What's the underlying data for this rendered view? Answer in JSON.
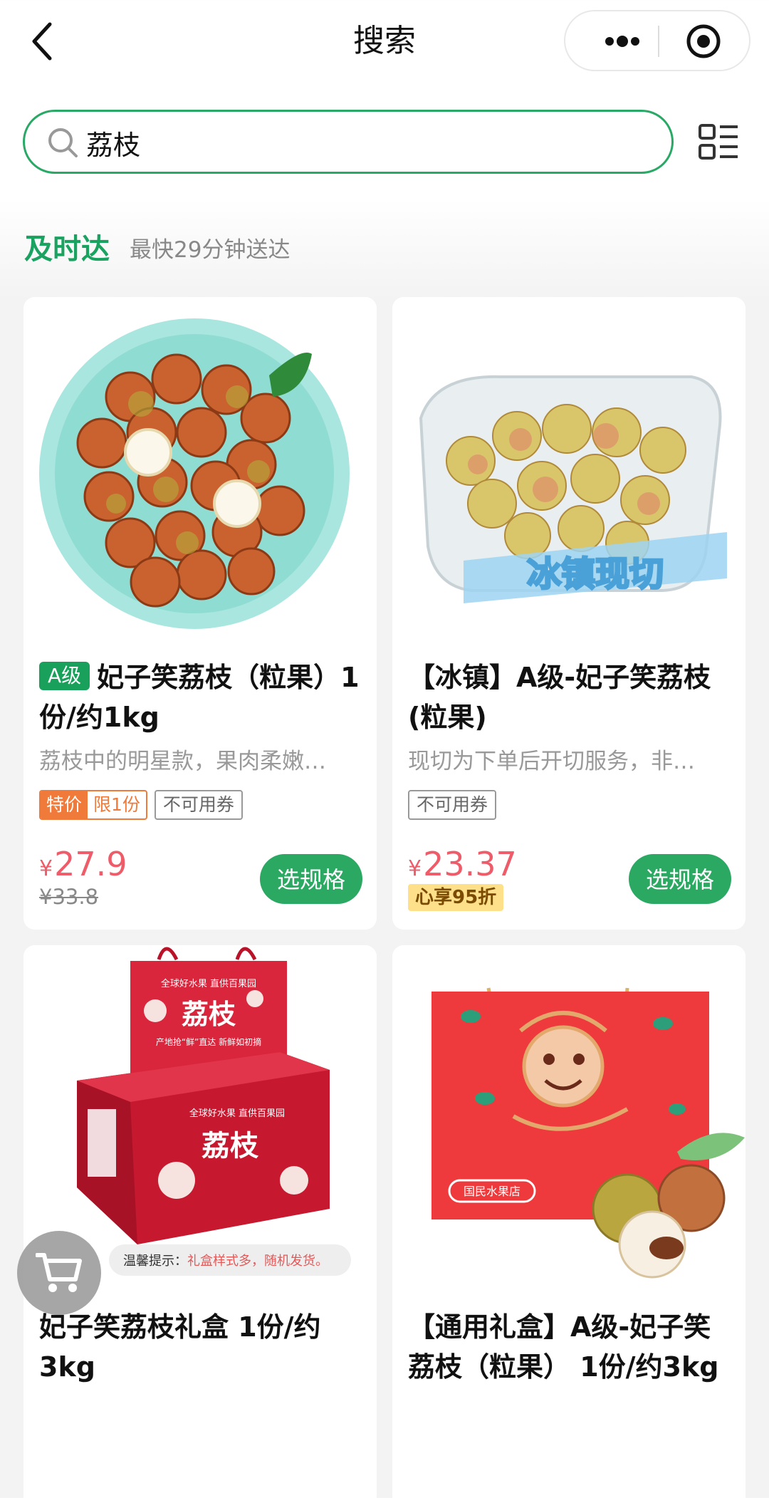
{
  "nav": {
    "title": "搜索"
  },
  "search": {
    "value": "荔枝",
    "placeholder": ""
  },
  "section": {
    "title": "及时达",
    "subtitle": "最快29分钟送达"
  },
  "products": [
    {
      "grade": "A级",
      "title": "妃子笑荔枝（粒果）1份/约1kg",
      "desc": "荔枝中的明星款，果肉柔嫩…",
      "promo_label": "特价",
      "promo_limit": "限1份",
      "coupon_note": "不可用券",
      "price_symbol": "¥",
      "price": "27.9",
      "original_price": "¥33.8",
      "button": "选规格"
    },
    {
      "title": "【冰镇】A级-妃子笑荔枝(粒果)",
      "desc": "现切为下单后开切服务，非…",
      "coupon_note": "不可用券",
      "price_symbol": "¥",
      "price": "23.37",
      "member_badge": "心享95折",
      "button": "选规格",
      "image_text": "冰镇现切"
    },
    {
      "title": "妃子笑荔枝礼盒 1份/约3kg",
      "image_text": {
        "bag_top": "全球好水果 直供百果园",
        "bag_title": "荔枝",
        "bag_sub": "产地抢“鲜”直达 新鲜如初摘",
        "box_top": "全球好水果 直供百果园",
        "box_title": "荔枝",
        "tip_label": "温馨提示：",
        "tip_text": "礼盒样式多，随机发货。"
      }
    },
    {
      "title": "【通用礼盒】A级-妃子笑荔枝（粒果） 1份/约3kg",
      "image_text": {
        "brand": "国民水果店"
      }
    }
  ],
  "colors": {
    "brand_green": "#2ba862",
    "price_red": "#ee5c6a",
    "promo_orange": "#f07a3a"
  }
}
